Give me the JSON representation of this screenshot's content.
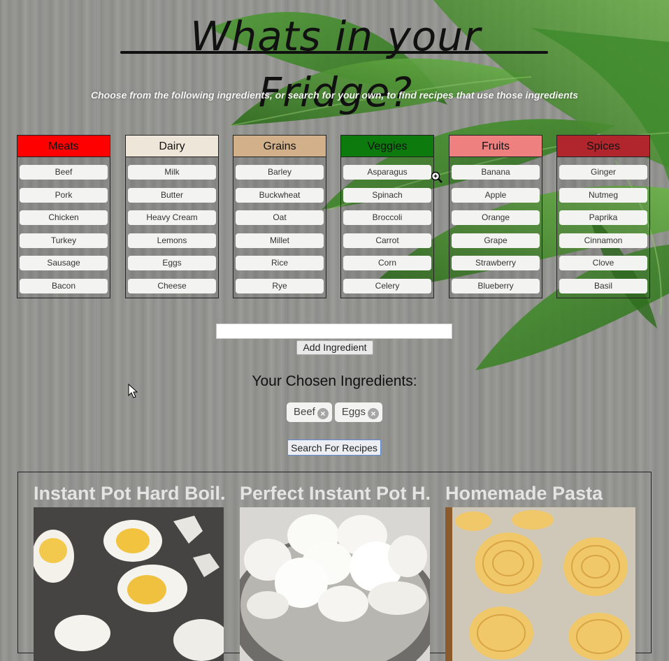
{
  "title": "Whats in your Fridge?",
  "subtitle": "Choose from the following ingredients, or search for your own, to find recipes that use those ingredients",
  "categories": [
    {
      "name": "Meats",
      "color": "#ff0000",
      "items": [
        "Beef",
        "Pork",
        "Chicken",
        "Turkey",
        "Sausage",
        "Bacon"
      ]
    },
    {
      "name": "Dairy",
      "color": "#efe6da",
      "items": [
        "Milk",
        "Butter",
        "Heavy Cream",
        "Lemons",
        "Eggs",
        "Cheese"
      ]
    },
    {
      "name": "Grains",
      "color": "#d1b08a",
      "items": [
        "Barley",
        "Buckwheat",
        "Oat",
        "Millet",
        "Rice",
        "Rye"
      ]
    },
    {
      "name": "Veggies",
      "color": "#0c7a0c",
      "items": [
        "Asparagus",
        "Spinach",
        "Broccoli",
        "Carrot",
        "Corn",
        "Celery"
      ]
    },
    {
      "name": "Fruits",
      "color": "#ef8080",
      "items": [
        "Banana",
        "Apple",
        "Orange",
        "Grape",
        "Strawberry",
        "Blueberry"
      ]
    },
    {
      "name": "Spices",
      "color": "#b0262c",
      "items": [
        "Ginger",
        "Nutmeg",
        "Paprika",
        "Cinnamon",
        "Clove",
        "Basil"
      ]
    }
  ],
  "search": {
    "value": "",
    "add_label": "Add Ingredient"
  },
  "chosen": {
    "title": "Your Chosen Ingredients:",
    "chips": [
      "Beef",
      "Eggs"
    ],
    "remove_icon": "×"
  },
  "search_recipes_label": "Search For Recipes",
  "recipes": [
    {
      "title": "Instant Pot Hard Boil...",
      "image": "hard boiled eggs"
    },
    {
      "title": "Perfect Instant Pot H...",
      "image": "whole eggs in steamer"
    },
    {
      "title": "Homemade Pasta",
      "image": "fresh pasta nests"
    }
  ]
}
